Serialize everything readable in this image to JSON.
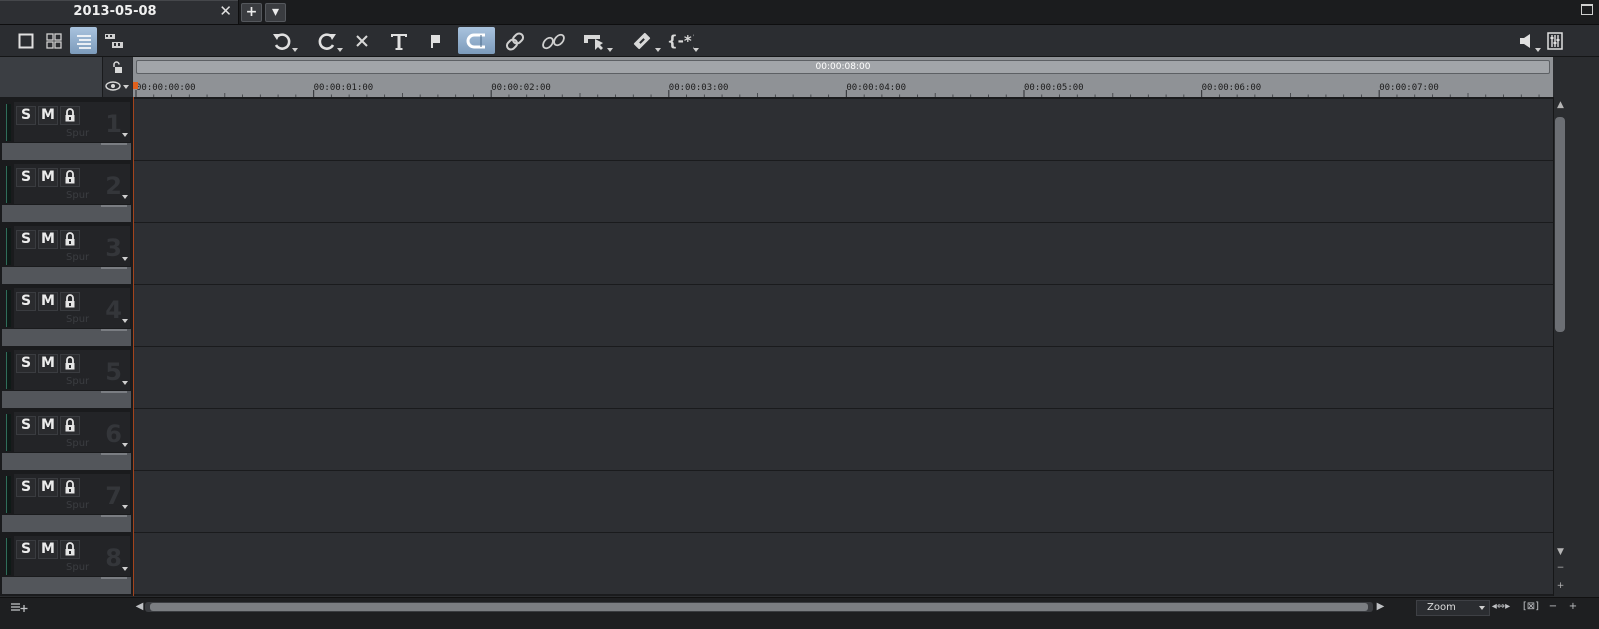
{
  "tab": {
    "title": "2013-05-08",
    "close_label": "✕",
    "new_tab_label": "+",
    "tab_menu_label": "▾"
  },
  "ruler": {
    "overview_time": "00:00:08:00",
    "ticks": [
      "00:00:00:00",
      "00:00:01:00",
      "00:00:02:00",
      "00:00:03:00",
      "00:00:04:00",
      "00:00:05:00",
      "00:00:06:00",
      "00:00:07:00"
    ]
  },
  "track_buttons": {
    "solo": "S",
    "mute": "M"
  },
  "tracks": [
    {
      "number": "1",
      "name": "Spur"
    },
    {
      "number": "2",
      "name": "Spur"
    },
    {
      "number": "3",
      "name": "Spur"
    },
    {
      "number": "4",
      "name": "Spur"
    },
    {
      "number": "5",
      "name": "Spur"
    },
    {
      "number": "6",
      "name": "Spur"
    },
    {
      "number": "7",
      "name": "Spur"
    },
    {
      "number": "8",
      "name": "Spur"
    }
  ],
  "status": {
    "zoom_label": "Zoom"
  },
  "colors": {
    "accent_active": "#8eacc9",
    "playhead": "#e0601c",
    "meter": "#2f6e5a"
  }
}
